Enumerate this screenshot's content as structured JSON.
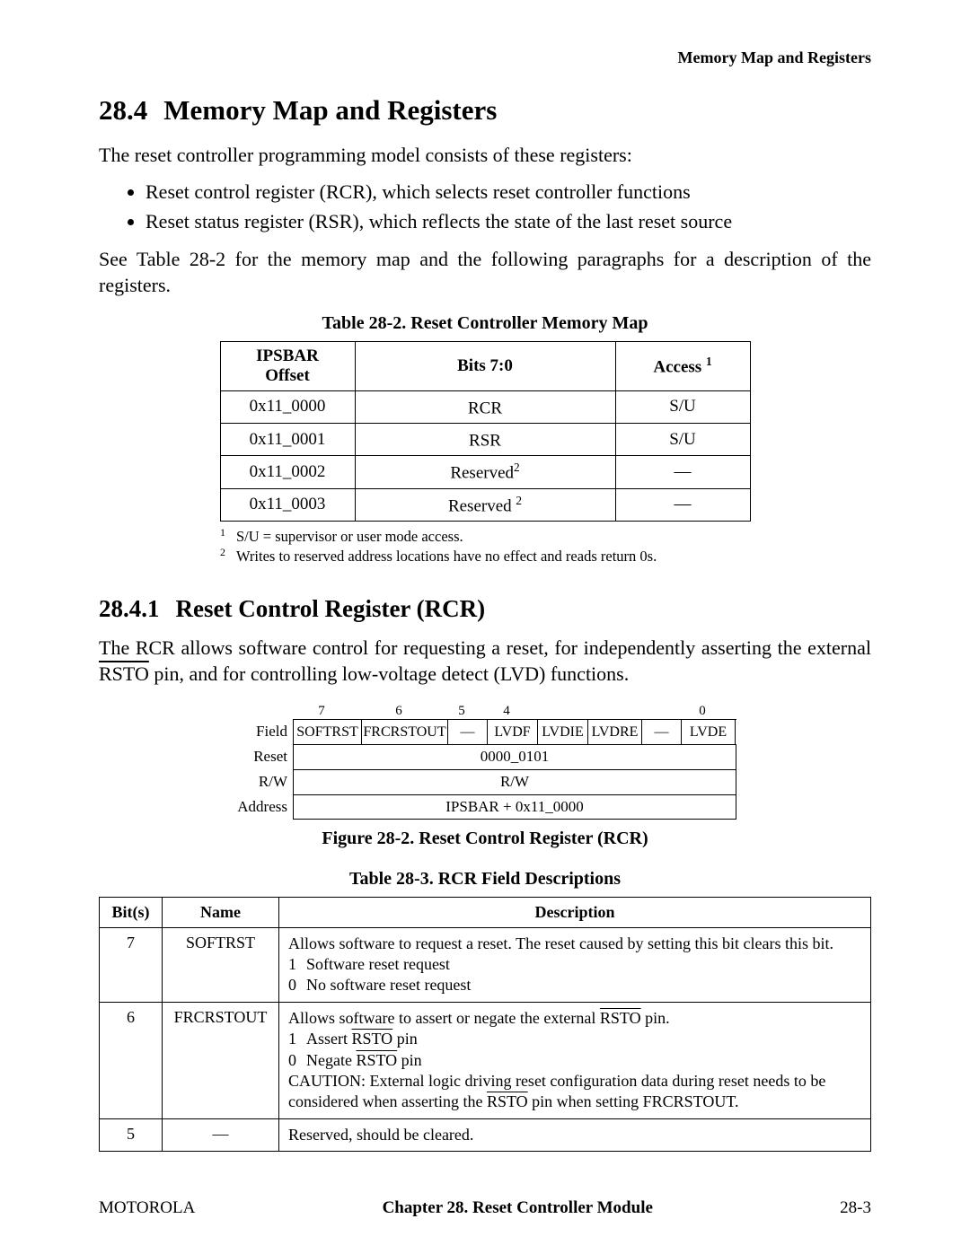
{
  "running_head": "Memory Map and Registers",
  "section": {
    "num": "28.4",
    "title": "Memory Map and Registers"
  },
  "intro": "The reset controller programming model consists of these registers:",
  "bullets": [
    "Reset control register (RCR), which selects reset controller functions",
    "Reset status register (RSR), which reflects the state of the last reset source"
  ],
  "post_bullets": "See Table 28-2 for the memory map and the following paragraphs for a description of the registers.",
  "table28_2": {
    "caption": "Table 28-2. Reset Controller Memory Map",
    "headers": {
      "c0": "IPSBAR Offset",
      "c1": "Bits 7:0",
      "c2": "Access",
      "c2_sup": "1"
    },
    "rows": [
      {
        "offset": "0x11_0000",
        "bits": "RCR",
        "bits_sup": "",
        "access": "S/U"
      },
      {
        "offset": "0x11_0001",
        "bits": "RSR",
        "bits_sup": "",
        "access": "S/U"
      },
      {
        "offset": "0x11_0002",
        "bits": "Reserved",
        "bits_sup": "2",
        "access": "—"
      },
      {
        "offset": "0x11_0003",
        "bits": "Reserved",
        "bits_sup": "2",
        "access": "—"
      }
    ],
    "footnotes": [
      {
        "mark": "1",
        "text": "S/U = supervisor or user mode access."
      },
      {
        "mark": "2",
        "text": "Writes to reserved address locations have no effect and reads return 0s."
      }
    ]
  },
  "subsection": {
    "num": "28.4.1",
    "title": "Reset Control Register (RCR)"
  },
  "rcr_para_pre": "The RCR allows software control for requesting a reset, for independently asserting the external ",
  "rcr_para_rsto": "RSTO",
  "rcr_para_post": " pin, and for controlling low-voltage detect (LVD) functions.",
  "regfig": {
    "bits": [
      "7",
      "6",
      "5",
      "4",
      "",
      "",
      "",
      "0"
    ],
    "field_label": "Field",
    "fields": [
      "SOFTRST",
      "FRCRSTOUT",
      "—",
      "LVDF",
      "LVDIE",
      "LVDRE",
      "—",
      "LVDE"
    ],
    "reset_label": "Reset",
    "reset_value": "0000_0101",
    "rw_label": "R/W",
    "rw_value": "R/W",
    "addr_label": "Address",
    "addr_value": "IPSBAR + 0x11_0000",
    "caption": "Figure 28-2. Reset Control Register (RCR)"
  },
  "table28_3": {
    "caption": "Table 28-3. RCR Field Descriptions",
    "headers": {
      "c0": "Bit(s)",
      "c1": "Name",
      "c2": "Description"
    },
    "rows": [
      {
        "bits": "7",
        "name": "SOFTRST",
        "desc_lead": "Allows software to request a reset. The reset caused by setting this bit clears this bit.",
        "values": [
          {
            "k": "1",
            "v": "Software reset request"
          },
          {
            "k": "0",
            "v": "No software reset request"
          }
        ],
        "desc_tail": ""
      },
      {
        "bits": "6",
        "name": "FRCRSTOUT",
        "desc_lead_pre": "Allows software to assert or negate the external ",
        "desc_lead_rsto": "RSTO",
        "desc_lead_post": " pin.",
        "values": [
          {
            "k": "1",
            "v_pre": "Assert ",
            "v_rsto": "RSTO",
            "v_post": " pin"
          },
          {
            "k": "0",
            "v_pre": "Negate ",
            "v_rsto": "RSTO",
            "v_post": " pin"
          }
        ],
        "desc_tail_pre": "CAUTION: External logic driving reset configuration data during reset needs to be considered when asserting the ",
        "desc_tail_rsto": "RSTO",
        "desc_tail_post": " pin when setting FRCRSTOUT."
      },
      {
        "bits": "5",
        "name": "—",
        "desc_lead": "Reserved, should be cleared.",
        "values": [],
        "desc_tail": ""
      }
    ]
  },
  "footer": {
    "left": "MOTOROLA",
    "center": "Chapter 28.  Reset Controller Module",
    "right": "28-3"
  }
}
